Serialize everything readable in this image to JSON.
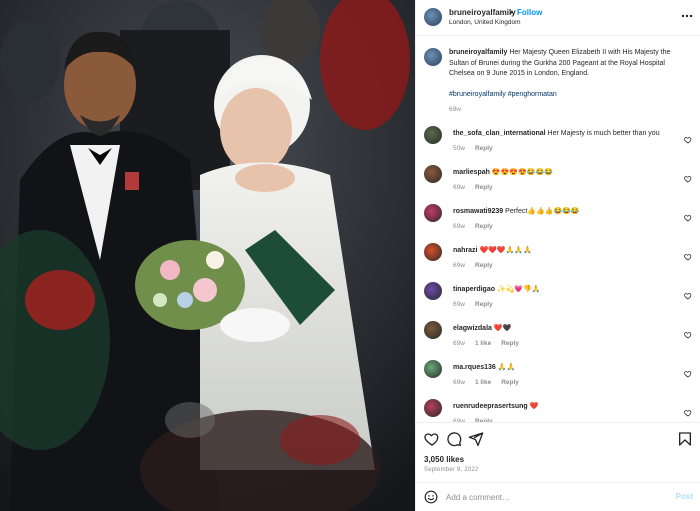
{
  "header": {
    "username": "bruneiroyalfamily",
    "separator": "•",
    "follow_label": "Follow",
    "location": "London, United Kingdom",
    "more_icon": "more-dots-icon"
  },
  "caption": {
    "username": "bruneiroyalfamily",
    "text": "Her Majesty Queen Elizabeth II with His Majesty the Sultan of Brunei during the Gurkha 200 Pageant at the Royal Hospital Chelsea on 9 June 2015 in London, England.",
    "hashtags": "#bruneiroyalfamily #penghormatan",
    "time": "69w"
  },
  "comments": [
    {
      "username": "the_sofa_clan_international",
      "text": "Her Majesty is much better than you",
      "time": "50w",
      "likes": "",
      "reply": "Reply",
      "avatar_color": "#5a6b4a"
    },
    {
      "username": "marliespah",
      "text": "😍😍😍😍😂😂😂",
      "time": "69w",
      "likes": "",
      "reply": "Reply",
      "avatar_color": "#8a5a3c"
    },
    {
      "username": "rosmawati9239",
      "text": "Perfect👍👍👍😂😂😂",
      "time": "69w",
      "likes": "",
      "reply": "Reply",
      "avatar_color": "#c23b6a"
    },
    {
      "username": "nahrazi",
      "text": "❤️❤️❤️🙏🙏🙏",
      "time": "69w",
      "likes": "",
      "reply": "Reply",
      "avatar_color": "#d94f2a"
    },
    {
      "username": "tinaperdigao",
      "text": "✨💫💗👎🙏",
      "time": "69w",
      "likes": "",
      "reply": "Reply",
      "avatar_color": "#6b4aa8"
    },
    {
      "username": "elagwizdala",
      "text": "❤️🖤",
      "time": "69w",
      "likes": "1 like",
      "reply": "Reply",
      "avatar_color": "#7a5a3a"
    },
    {
      "username": "ma.rques136",
      "text": "🙏🙏",
      "time": "69w",
      "likes": "1 like",
      "reply": "Reply",
      "avatar_color": "#6aa87a"
    },
    {
      "username": "ruenrudeeprasertsung",
      "text": "❤️",
      "time": "69w",
      "likes": "",
      "reply": "Reply",
      "avatar_color": "#b5405a"
    }
  ],
  "actions": {
    "like_icon": "heart-icon",
    "comment_icon": "comment-bubble-icon",
    "share_icon": "share-paper-plane-icon",
    "save_icon": "bookmark-icon",
    "likes_text": "3,050 likes",
    "date_text": "September 9, 2022"
  },
  "add_comment": {
    "emoji_icon": "smiley-icon",
    "placeholder": "Add a comment…",
    "post_label": "Post"
  },
  "colors": {
    "link_blue": "#0095f6",
    "hashtag_blue": "#00376b",
    "muted": "#8e8e8e",
    "post_disabled": "#b2dffc"
  }
}
